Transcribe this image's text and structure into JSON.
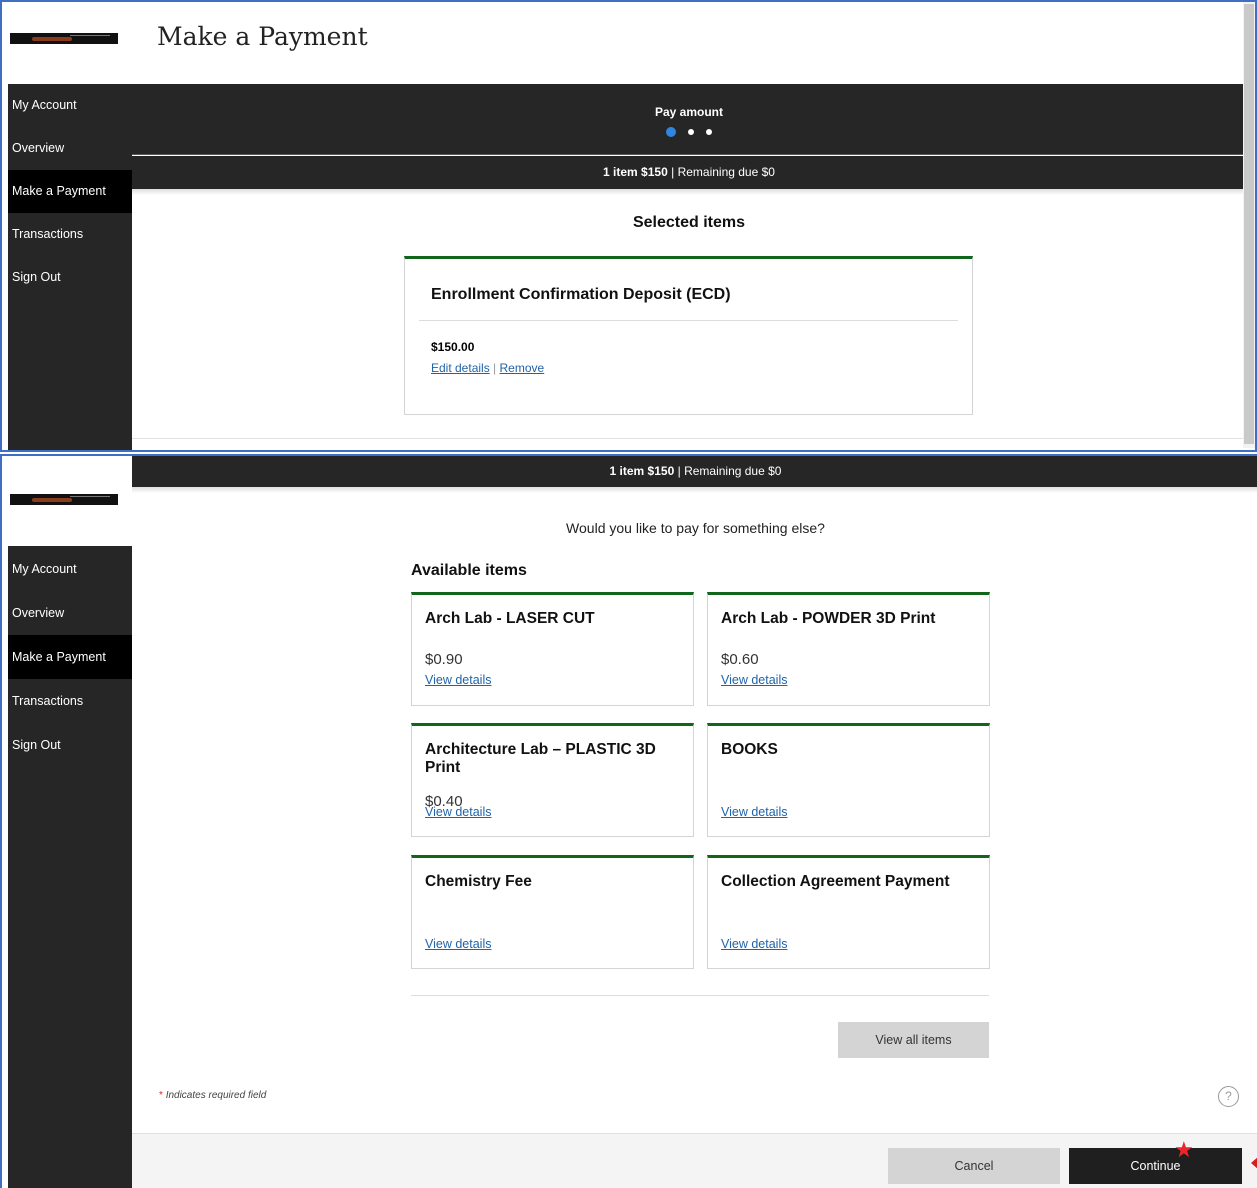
{
  "sidebar": {
    "items": [
      {
        "label": "My Account"
      },
      {
        "label": "Overview"
      },
      {
        "label": "Make a Payment"
      },
      {
        "label": "Transactions"
      },
      {
        "label": "Sign Out"
      }
    ],
    "active_item": "Make a Payment"
  },
  "header": {
    "title": "Make a Payment"
  },
  "stepper": {
    "label": "Pay amount",
    "step": 1,
    "total_steps": 3,
    "active_color": "#2f86e0"
  },
  "summary": {
    "count_text": "1 item $150",
    "separator": "|",
    "remaining_text": "Remaining due $0"
  },
  "selected": {
    "heading": "Selected items",
    "items": [
      {
        "title": "Enrollment Confirmation Deposit (ECD)",
        "amount": "$150.00",
        "edit_label": "Edit details",
        "separator": "|",
        "remove_label": "Remove"
      }
    ]
  },
  "available": {
    "question": "Would you like to pay for something else?",
    "heading": "Available items",
    "items": [
      {
        "title": "Arch Lab - LASER CUT",
        "price": "$0.90",
        "link": "View details"
      },
      {
        "title": "Arch Lab - POWDER 3D Print",
        "price": "$0.60",
        "link": "View details"
      },
      {
        "title": "Architecture Lab – PLASTIC 3D Print",
        "price": "$0.40",
        "link": "View details"
      },
      {
        "title": "BOOKS",
        "price": "",
        "link": "View details"
      },
      {
        "title": "Chemistry Fee",
        "price": "",
        "link": "View details"
      },
      {
        "title": "Collection Agreement Payment",
        "price": "",
        "link": "View details"
      }
    ],
    "view_all_label": "View all items"
  },
  "form": {
    "required_star": "*",
    "required_note": "Indicates required field"
  },
  "help": {
    "icon": "question-circle-icon",
    "glyph": "?"
  },
  "footer": {
    "cancel_label": "Cancel",
    "continue_label": "Continue"
  },
  "annotations": {
    "star_icon": "red-star-icon",
    "arrow_icon": "red-arrow-left-icon"
  },
  "colors": {
    "accent_green": "#11661b",
    "dark_bar": "#262626",
    "link_blue": "#1f63a8",
    "required_red": "#d9261c"
  }
}
